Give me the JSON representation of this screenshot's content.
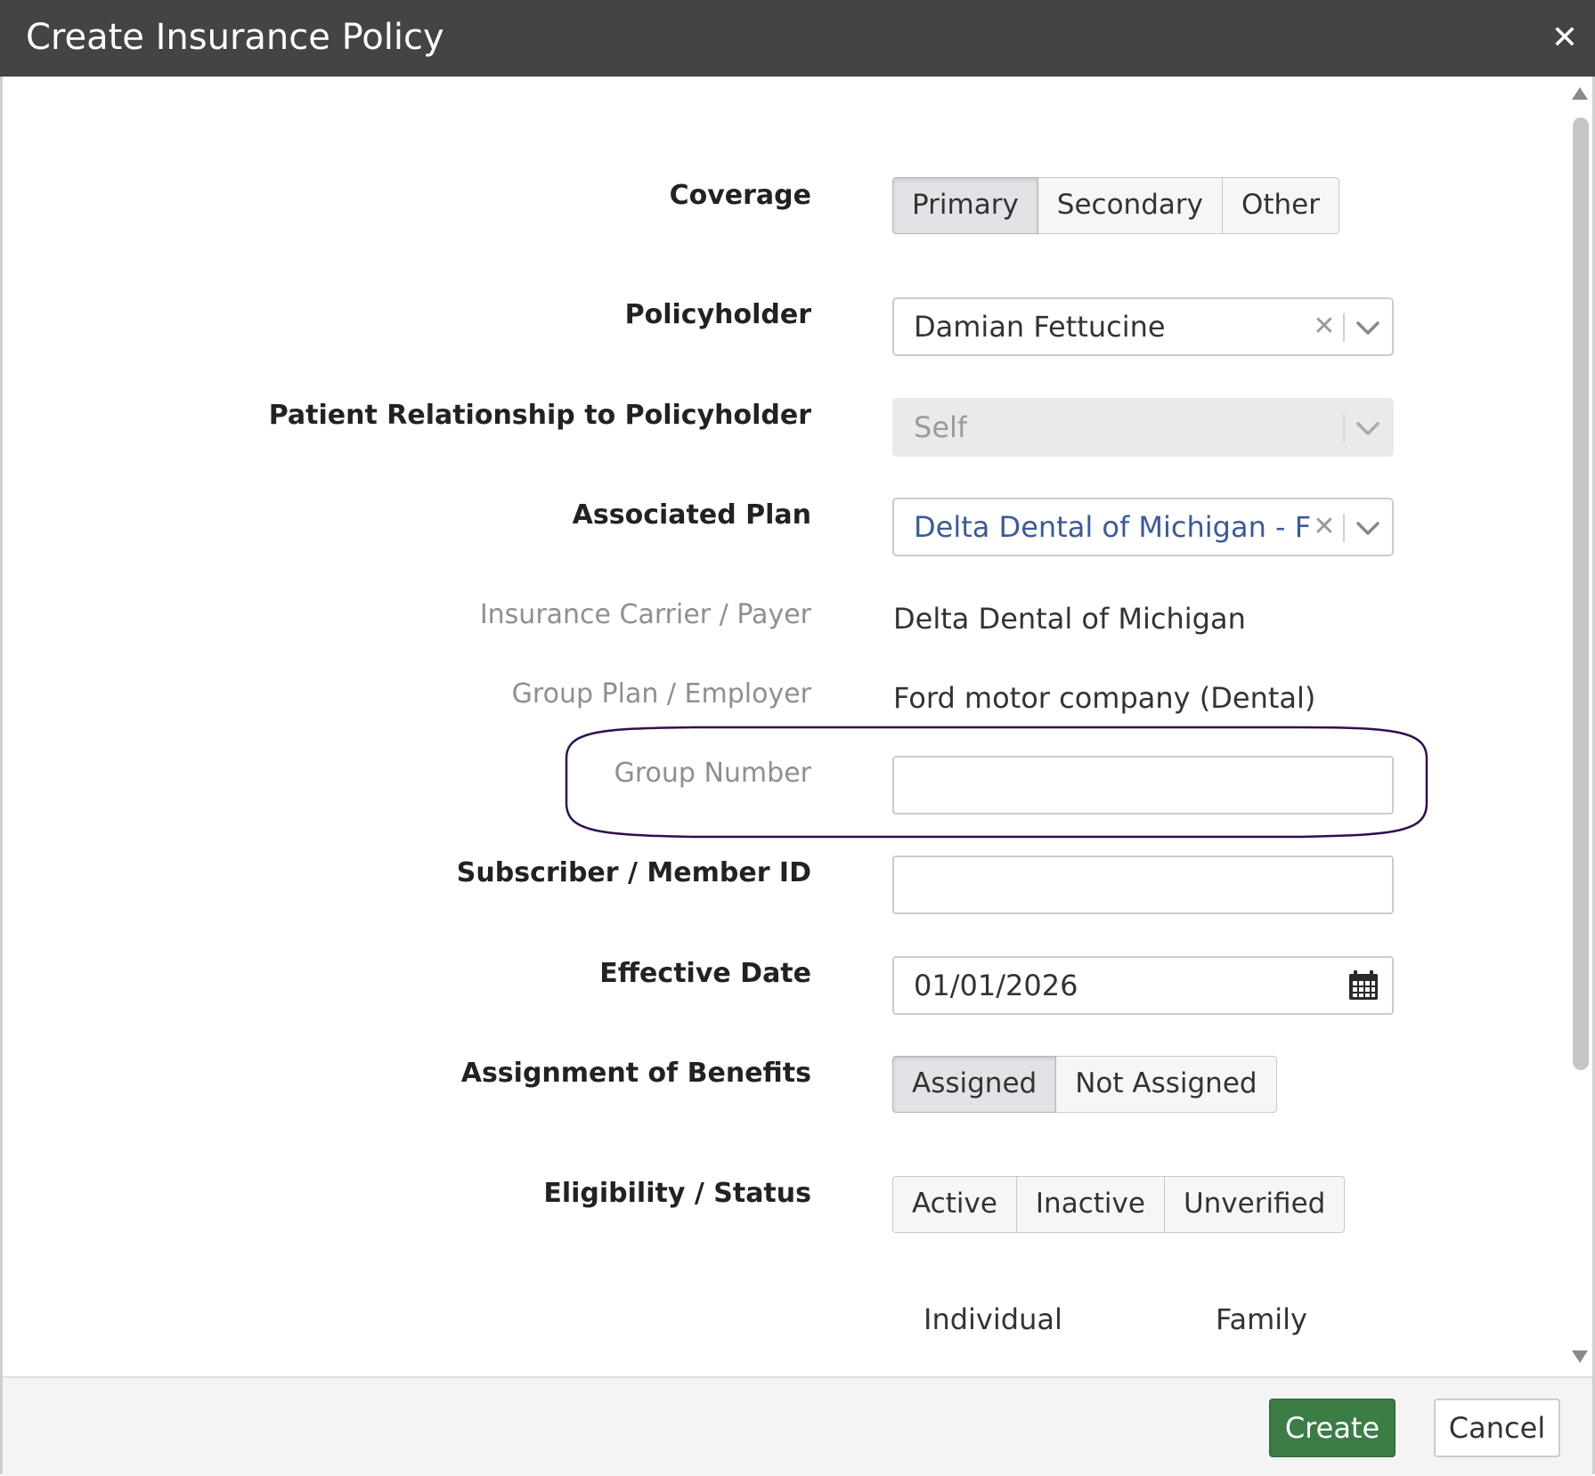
{
  "dialog": {
    "title": "Create Insurance Policy"
  },
  "form": {
    "coverage": {
      "label": "Coverage",
      "options": [
        "Primary",
        "Secondary",
        "Other"
      ],
      "selected": "Primary"
    },
    "policyholder": {
      "label": "Policyholder",
      "value": "Damian Fettucine"
    },
    "relationship": {
      "label": "Patient Relationship to Policyholder",
      "value": "Self"
    },
    "associated_plan": {
      "label": "Associated Plan",
      "value": "Delta Dental of Michigan - For"
    },
    "carrier": {
      "label": "Insurance Carrier / Payer",
      "value": "Delta Dental of Michigan"
    },
    "group_plan": {
      "label": "Group Plan / Employer",
      "value": "Ford motor company (Dental)"
    },
    "group_number": {
      "label": "Group Number",
      "value": ""
    },
    "member_id": {
      "label": "Subscriber / Member ID",
      "value": ""
    },
    "effective_date": {
      "label": "Effective Date",
      "value": "01/01/2026"
    },
    "assignment": {
      "label": "Assignment of Benefits",
      "options": [
        "Assigned",
        "Not Assigned"
      ],
      "selected": "Assigned"
    },
    "eligibility": {
      "label": "Eligibility / Status",
      "options": [
        "Active",
        "Inactive",
        "Unverified"
      ]
    },
    "columns": {
      "individual": "Individual",
      "family": "Family"
    }
  },
  "footer": {
    "create_label": "Create",
    "cancel_label": "Cancel"
  },
  "colors": {
    "title_bar": "#444444",
    "create_button": "#3b7d45",
    "plan_link": "#3a5a9a",
    "highlight_ellipse": "#2e0f4f"
  },
  "icons": {
    "close": "close-icon",
    "clear": "clear-icon",
    "chevron": "chevron-down-icon",
    "calendar": "calendar-icon"
  }
}
